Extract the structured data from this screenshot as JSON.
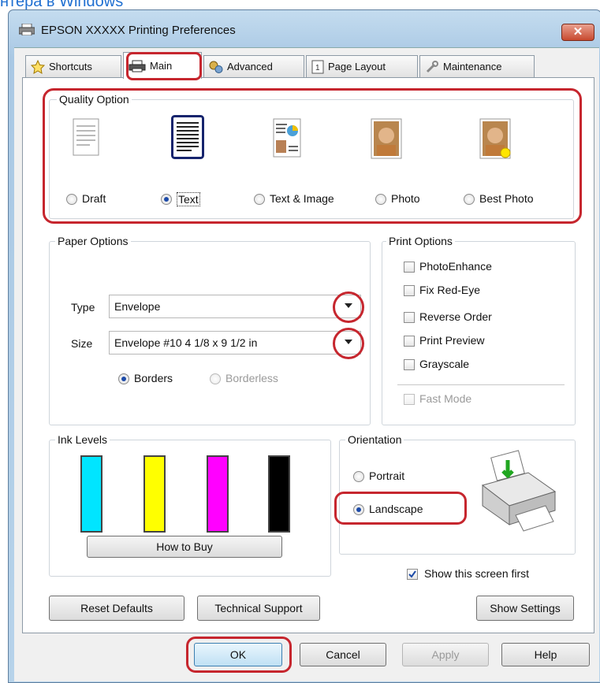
{
  "page_caption": "нтера в Windows",
  "window": {
    "title": "EPSON XXXXX  Printing Preferences",
    "close_glyph": "✕"
  },
  "tabs": [
    "Shortcuts",
    "Main",
    "Advanced",
    "Page Layout",
    "Maintenance"
  ],
  "quality": {
    "legend": "Quality Option",
    "options": [
      "Draft",
      "Text",
      "Text & Image",
      "Photo",
      "Best Photo"
    ],
    "selected": "Text"
  },
  "paper": {
    "legend": "Paper Options",
    "type_label": "Type",
    "type_value": "Envelope",
    "size_label": "Size",
    "size_value": "Envelope #10 4 1/8 x 9 1/2 in",
    "borders": "Borders",
    "borderless": "Borderless"
  },
  "print_options": {
    "legend": "Print Options",
    "items": [
      "PhotoEnhance",
      "Fix Red-Eye",
      "Reverse Order",
      "Print Preview",
      "Grayscale"
    ],
    "fast_mode": "Fast Mode"
  },
  "ink": {
    "legend": "Ink Levels",
    "colors": [
      "#00e5ff",
      "#ffff00",
      "#ff00ff",
      "#000000"
    ],
    "how_to_buy": "How to Buy"
  },
  "orientation": {
    "legend": "Orientation",
    "portrait": "Portrait",
    "landscape": "Landscape",
    "selected": "Landscape"
  },
  "show_first": "Show this screen first",
  "buttons": {
    "reset": "Reset Defaults",
    "tech": "Technical Support",
    "show_settings": "Show Settings",
    "ok": "OK",
    "cancel": "Cancel",
    "apply": "Apply",
    "help": "Help"
  },
  "accent": {
    "highlight": "#c6262e",
    "link": "#1f6fd1"
  }
}
